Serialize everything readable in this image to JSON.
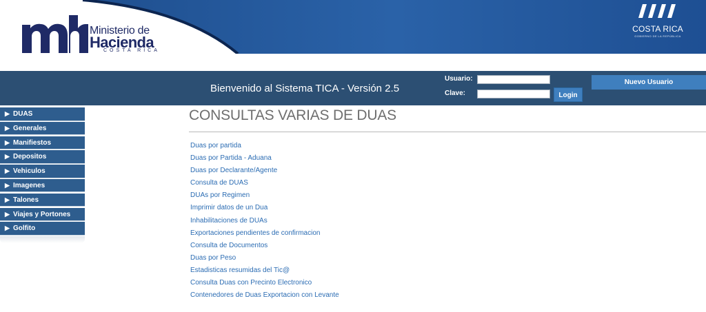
{
  "header": {
    "logo_line1": "Ministerio de",
    "logo_line2": "Hacienda",
    "logo_line3": "COSTA RICA",
    "gov_logo_text": "COSTA RICA",
    "gov_logo_sub": "GOBIERNO DE LA REPÚBLICA",
    "colors": {
      "banner_blue": "#2a62a8",
      "bar_blue": "#2c4f73",
      "logo_navy": "#1f2a66"
    }
  },
  "topbar": {
    "welcome": "Bienvenido al Sistema TICA - Versión 2.5",
    "user_label": "Usuario:",
    "password_label": "Clave:",
    "user_value": "",
    "password_value": "",
    "login_label": "Login",
    "new_user_label": "Nuevo Usuario"
  },
  "sidebar": {
    "items": [
      {
        "label": "DUAS"
      },
      {
        "label": "Generales"
      },
      {
        "label": "Manifiestos"
      },
      {
        "label": "Depositos"
      },
      {
        "label": "Vehiculos"
      },
      {
        "label": "Imagenes"
      },
      {
        "label": "Talones"
      },
      {
        "label": "Viajes y Portones"
      },
      {
        "label": "Golfito"
      }
    ],
    "arrow_glyph": "▶"
  },
  "main": {
    "title": "CONSULTAS VARIAS DE DUAS",
    "links": [
      "Duas por partida",
      "Duas por Partida - Aduana",
      "Duas por Declarante/Agente",
      "Consulta de DUAS",
      "DUAs por Regimen",
      "Imprimir datos de un Dua",
      "Inhabilitaciones de DUAs",
      "Exportaciones pendientes de confirmacion",
      "Consulta de Documentos",
      "Duas por Peso",
      "Estadisticas resumidas del Tic@",
      "Consulta Duas con Precinto Electronico",
      "Contenedores de Duas Exportacion con Levante"
    ]
  }
}
